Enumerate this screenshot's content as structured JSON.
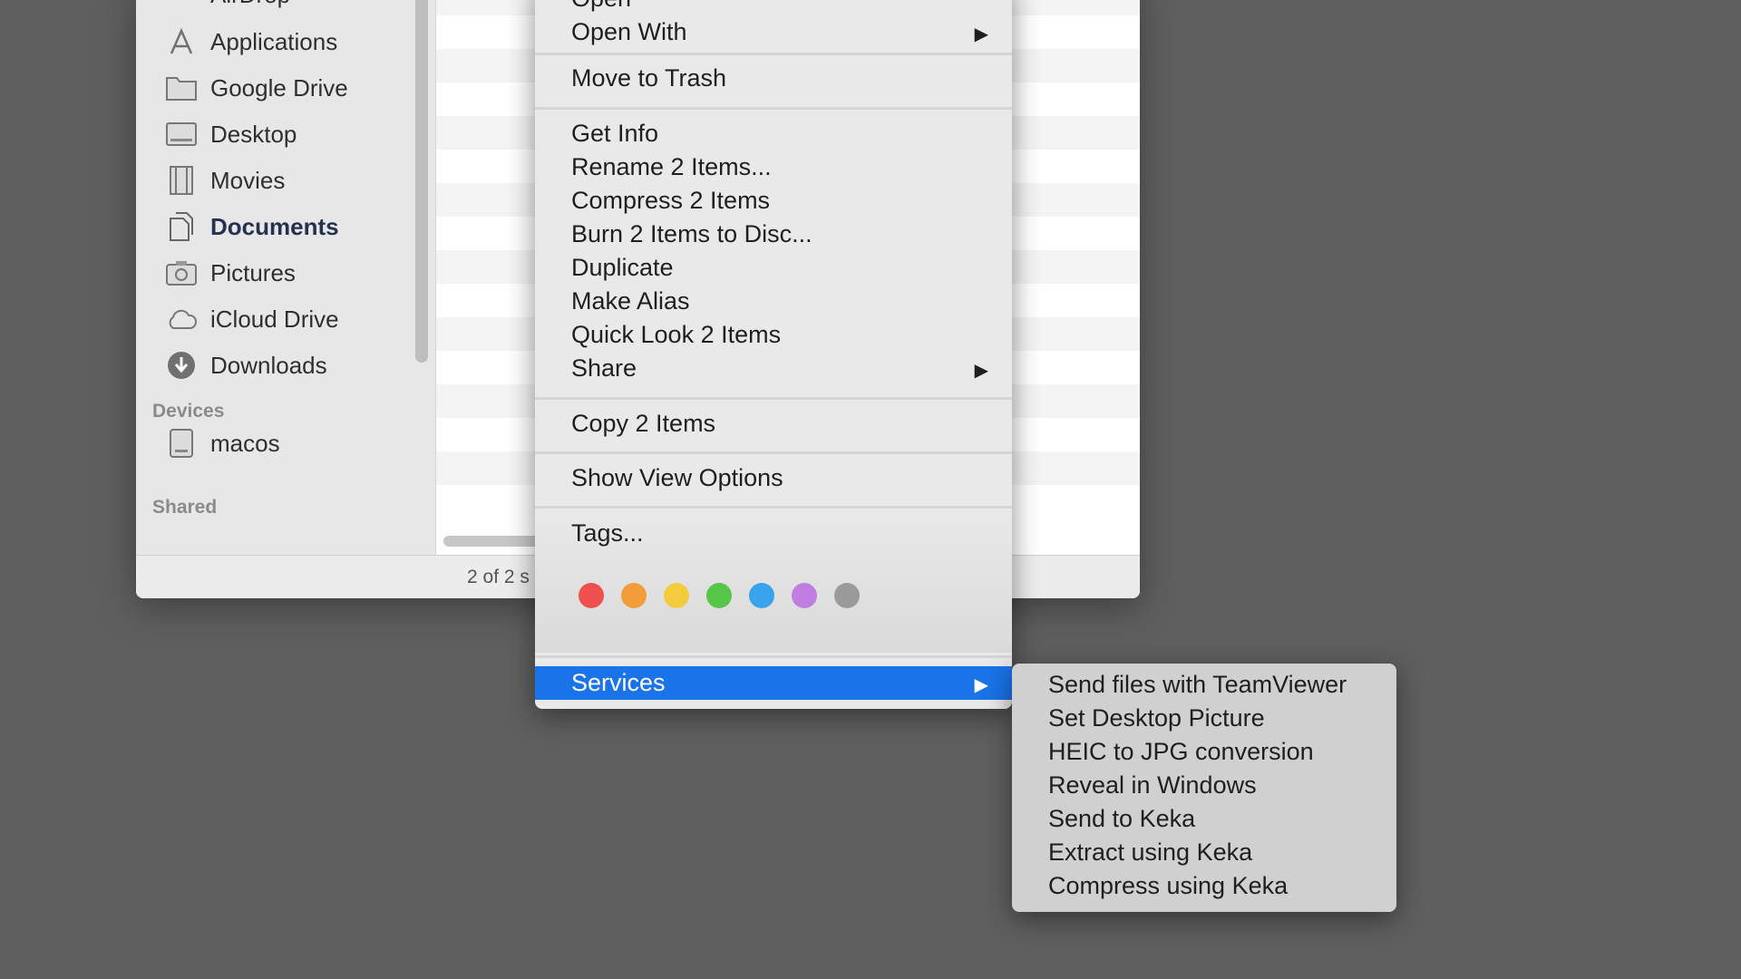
{
  "sidebar": {
    "items": [
      {
        "label": "AirDrop",
        "icon": "airdrop-icon"
      },
      {
        "label": "Applications",
        "icon": "applications-icon"
      },
      {
        "label": "Google Drive",
        "icon": "folder-icon"
      },
      {
        "label": "Desktop",
        "icon": "desktop-icon"
      },
      {
        "label": "Movies",
        "icon": "movies-icon"
      },
      {
        "label": "Documents",
        "icon": "documents-icon"
      },
      {
        "label": "Pictures",
        "icon": "camera-icon"
      },
      {
        "label": "iCloud Drive",
        "icon": "cloud-icon"
      },
      {
        "label": "Downloads",
        "icon": "download-icon"
      }
    ],
    "devices_heading": "Devices",
    "devices": [
      {
        "label": "macos",
        "icon": "disk-icon"
      }
    ],
    "shared_heading": "Shared"
  },
  "status": {
    "text": "2 of 2 s"
  },
  "context_menu": {
    "open": "Open",
    "open_with": "Open With",
    "move_to_trash": "Move to Trash",
    "get_info": "Get Info",
    "rename": "Rename 2 Items...",
    "compress": "Compress 2 Items",
    "burn": "Burn 2 Items to Disc...",
    "duplicate": "Duplicate",
    "make_alias": "Make Alias",
    "quick_look": "Quick Look 2 Items",
    "share": "Share",
    "copy": "Copy 2 Items",
    "show_view_options": "Show View Options",
    "tags": "Tags...",
    "tag_colors": [
      "#f0504d",
      "#f39c3a",
      "#f2cc3d",
      "#57c548",
      "#3aa3ee",
      "#c07ee0",
      "#9a9a9a"
    ],
    "services": "Services"
  },
  "services_submenu": [
    "Send files with TeamViewer",
    "Set Desktop Picture",
    "HEIC to JPG conversion",
    "Reveal in Windows",
    "Send to Keka",
    "Extract using Keka",
    "Compress using Keka"
  ]
}
